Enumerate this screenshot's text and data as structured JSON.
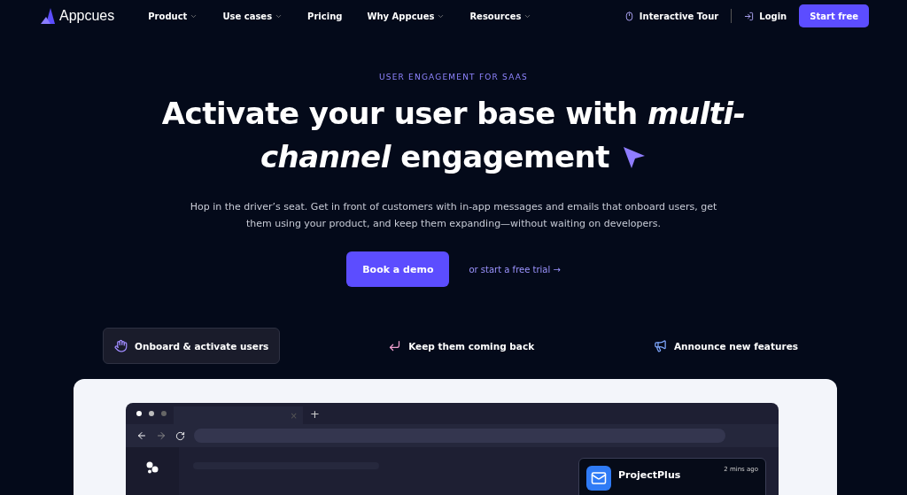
{
  "nav": {
    "brand": "Appcues",
    "items": [
      {
        "label": "Product",
        "has_menu": true
      },
      {
        "label": "Use cases",
        "has_menu": true
      },
      {
        "label": "Pricing",
        "has_menu": false
      },
      {
        "label": "Why Appcues",
        "has_menu": true
      },
      {
        "label": "Resources",
        "has_menu": true
      }
    ],
    "tour": "Interactive Tour",
    "login": "Login",
    "cta": "Start free"
  },
  "hero": {
    "eyebrow": "USER ENGAGEMENT FOR SAAS",
    "headline": [
      "Activate your user base with *multi-*",
      "*channel* engagement"
    ],
    "text": "Hop in the driver’s seat. Get in front of customers with in-app messages and emails that onboard users, get them using your product, and keep them expanding—without waiting on developers.",
    "primary": "Book a demo",
    "secondary": "or start a free trial →"
  },
  "tabs": [
    {
      "label": "Onboard & activate users",
      "kind": "wave",
      "selected": true
    },
    {
      "label": "Keep them coming back",
      "kind": "enter",
      "selected": false
    },
    {
      "label": "Announce new features",
      "kind": "megaphone",
      "selected": false
    }
  ],
  "browser": {
    "tab_close": "×",
    "new_tab": "+",
    "notification": {
      "title": "ProjectPlus",
      "time": "2 mins ago"
    }
  }
}
